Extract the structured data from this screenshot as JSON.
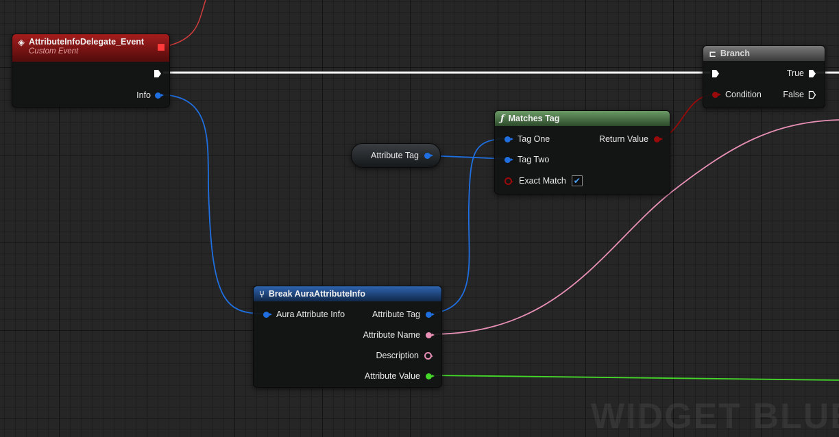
{
  "watermark": "WIDGET BLUEPRINT",
  "colors": {
    "exec_wire": "#ffffff",
    "struct_wire": "#1f6fe0",
    "bool_wire": "#9b0a0a",
    "string_wire": "#e88fb5",
    "float_wire": "#45d62a",
    "event_header": "#8a1313",
    "function_header": "#4a7a46",
    "branch_header": "#6a6a6a",
    "break_header": "#1e4a8a"
  },
  "event_node": {
    "title": "AttributeInfoDelegate_Event",
    "subtitle": "Custom Event",
    "icon": "event-diamond-icon",
    "out_pin": "Info"
  },
  "branch_node": {
    "title": "Branch",
    "icon": "branch-icon",
    "in_pin": "Condition",
    "true_pin": "True",
    "false_pin": "False"
  },
  "matches_node": {
    "title": "Matches Tag",
    "icon": "function-icon",
    "icon_glyph": "ƒ",
    "in_pins": [
      "Tag One",
      "Tag Two",
      "Exact Match"
    ],
    "out_pin": "Return Value",
    "exact_match_checked": true
  },
  "attr_tag_var": {
    "label": "Attribute Tag"
  },
  "break_node": {
    "title": "Break AuraAttributeInfo",
    "icon": "break-struct-icon",
    "in_pin": "Aura Attribute Info",
    "out_pins": [
      "Attribute Tag",
      "Attribute Name",
      "Description",
      "Attribute Value"
    ]
  }
}
